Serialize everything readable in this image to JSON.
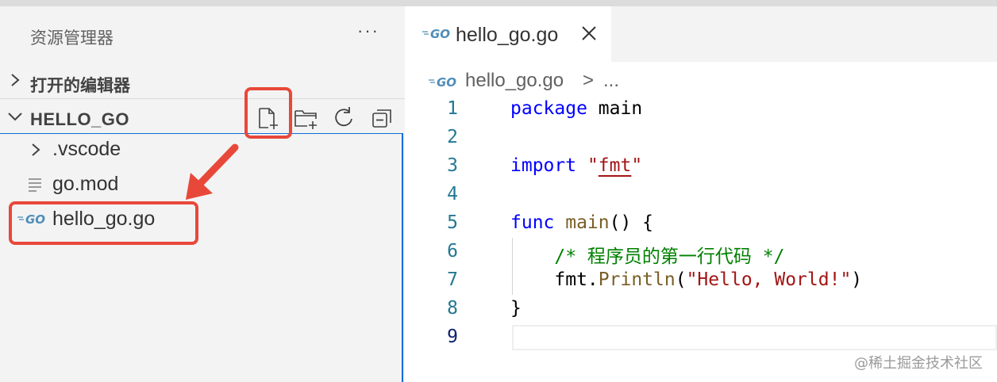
{
  "sidebar": {
    "title": "资源管理器",
    "more_label": "···",
    "open_editors_label": "打开的编辑器",
    "folder_label": "HELLO_GO",
    "toolbar": {
      "new_file": "new-file-icon",
      "new_folder": "new-folder-icon",
      "refresh": "refresh-icon",
      "collapse": "collapse-all-icon"
    },
    "tree": [
      {
        "label": ".vscode",
        "icon": "chevron-right-icon"
      },
      {
        "label": "go.mod",
        "icon": "file-lines-icon"
      },
      {
        "label": "hello_go.go",
        "icon": "go-file-icon"
      }
    ]
  },
  "editor": {
    "tab_label": "hello_go.go",
    "breadcrumb": {
      "file": "hello_go.go",
      "separator": ">",
      "more": "..."
    },
    "line_numbers": [
      "1",
      "2",
      "3",
      "4",
      "5",
      "6",
      "7",
      "8",
      "9"
    ],
    "code": {
      "l1_kw": "package",
      "l1_name": " main",
      "l3_kw": "import",
      "l3_q1": " \"",
      "l3_str": "fmt",
      "l3_q2": "\"",
      "l5_kw": "func",
      "l5_fn": " main",
      "l5_rest": "() {",
      "l6_comment": "    /* 程序员的第一行代码 */",
      "l7_obj": "    fmt.",
      "l7_fn": "Println",
      "l7_open": "(",
      "l7_str": "\"Hello, World!\"",
      "l7_close": ")",
      "l8": "}"
    },
    "active_line": "9"
  },
  "watermark": "@稀土掘金技术社区",
  "colors": {
    "highlight": "#e8483a",
    "focus_border": "#0a6ed8",
    "keyword": "#0000ff",
    "string": "#a31515",
    "comment": "#008000",
    "function": "#795e26",
    "go_logo": "#4f8db8"
  }
}
